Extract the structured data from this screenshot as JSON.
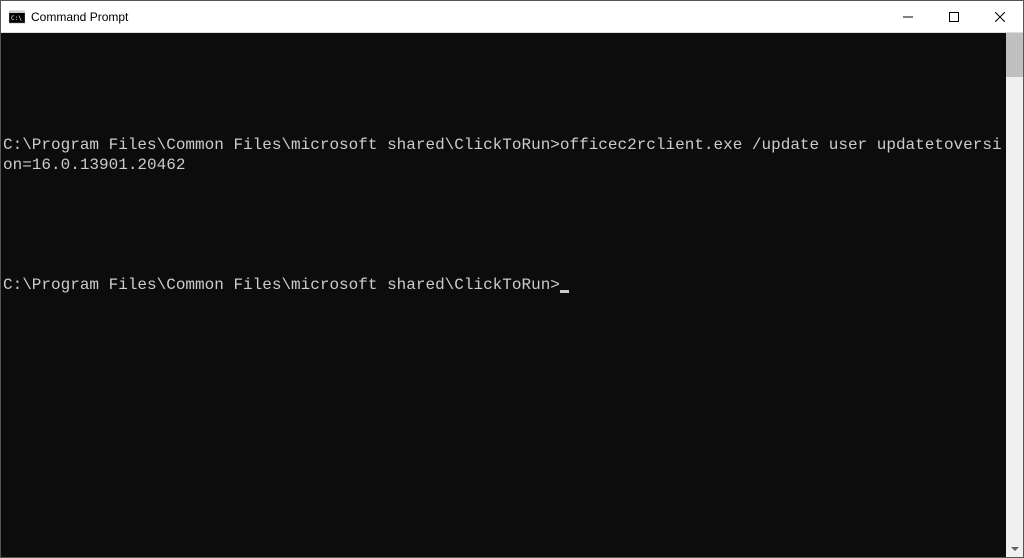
{
  "window": {
    "title": "Command Prompt"
  },
  "terminal": {
    "lines": [
      {
        "prompt": "C:\\Program Files\\Common Files\\microsoft shared\\ClickToRun>",
        "command": "officec2rclient.exe /update user updatetoversion=16.0.13901.20462"
      }
    ],
    "current_prompt": "C:\\Program Files\\Common Files\\microsoft shared\\ClickToRun>"
  }
}
